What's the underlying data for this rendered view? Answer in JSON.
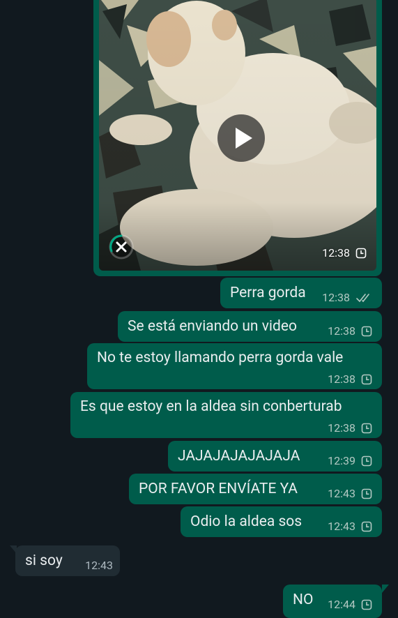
{
  "chat": {
    "video_message": {
      "time": "12:38"
    },
    "messages": [
      {
        "text": "Perra gorda",
        "time": "12:38"
      },
      {
        "text": "Se está enviando un video",
        "time": "12:38"
      },
      {
        "text": "No te estoy llamando perra gorda vale",
        "time": "12:38"
      },
      {
        "text": "Es que estoy en la aldea sin conberturab",
        "time": "12:38"
      },
      {
        "text": "JAJAJAJAJAJAJA",
        "time": "12:39"
      },
      {
        "text": "POR FAVOR ENVÍATE YA",
        "time": "12:43"
      },
      {
        "text": "Odio la aldea sos",
        "time": "12:43"
      },
      {
        "text": "si soy",
        "time": "12:43"
      },
      {
        "text": "NO",
        "time": "12:44"
      }
    ]
  },
  "icons": {
    "play": "play-icon",
    "cancel": "close-icon",
    "clock": "clock-icon",
    "read": "double-check-icon"
  },
  "colors": {
    "background": "#11191f",
    "outgoing_bubble": "#005c4b",
    "incoming_bubble": "#202c33",
    "text": "#e9edef",
    "meta_out": "#b3c9c3",
    "meta_in": "#aebac1",
    "accent": "#00a884"
  }
}
